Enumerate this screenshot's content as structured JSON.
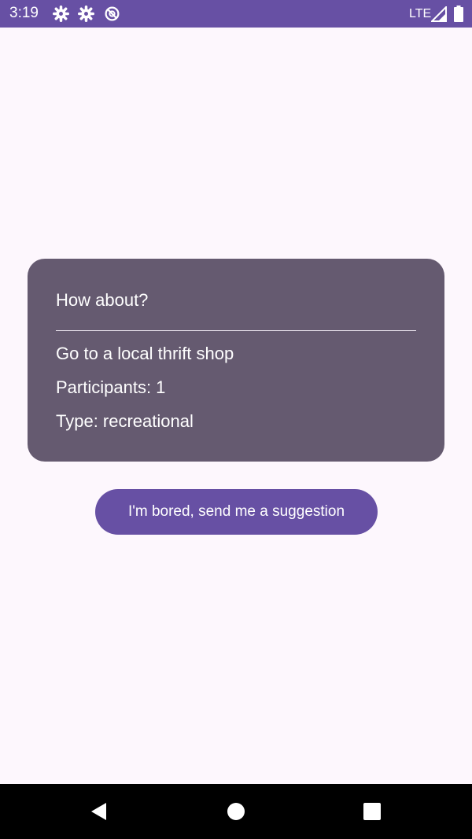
{
  "status_bar": {
    "time": "3:19",
    "icons": [
      "settings-icon",
      "settings-icon",
      "sync-disabled-icon"
    ],
    "network_label": "LTE",
    "right_icons": [
      "signal-icon",
      "battery-icon"
    ],
    "background_color": "#6750A4"
  },
  "card": {
    "heading": "How about?",
    "activity": "Go to a local thrift shop",
    "participants": "Participants: 1",
    "type": "Type: recreational",
    "background_color": "#655A70"
  },
  "action_button": {
    "label": "I'm bored, send me a suggestion",
    "background_color": "#6750A4"
  },
  "nav_bar": {
    "buttons": [
      "back-icon",
      "home-icon",
      "recents-icon"
    ]
  }
}
